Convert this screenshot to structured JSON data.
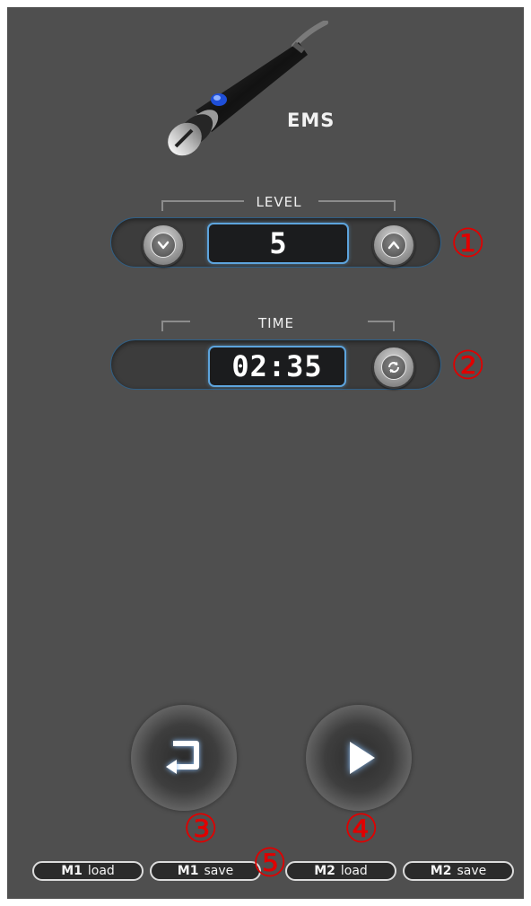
{
  "mode": {
    "label": "EMS"
  },
  "level": {
    "title": "LEVEL",
    "value": "5"
  },
  "time": {
    "title": "TIME",
    "value": "02:35"
  },
  "annotations": [
    "①",
    "②",
    "③",
    "④",
    "⑤"
  ],
  "memory_buttons": [
    {
      "slot": "M1",
      "action": "load"
    },
    {
      "slot": "M1",
      "action": "save"
    },
    {
      "slot": "M2",
      "action": "load"
    },
    {
      "slot": "M2",
      "action": "save"
    }
  ],
  "icons": {
    "handpiece": "ems-handpiece-icon",
    "level_down": "chevron-down-icon",
    "level_up": "chevron-up-icon",
    "time_reset": "refresh-icon",
    "back": "return-arrow-icon",
    "start": "play-icon"
  },
  "colors": {
    "background": "#4f4f4f",
    "accent": "#5da4dd",
    "annotation": "#e00000"
  }
}
